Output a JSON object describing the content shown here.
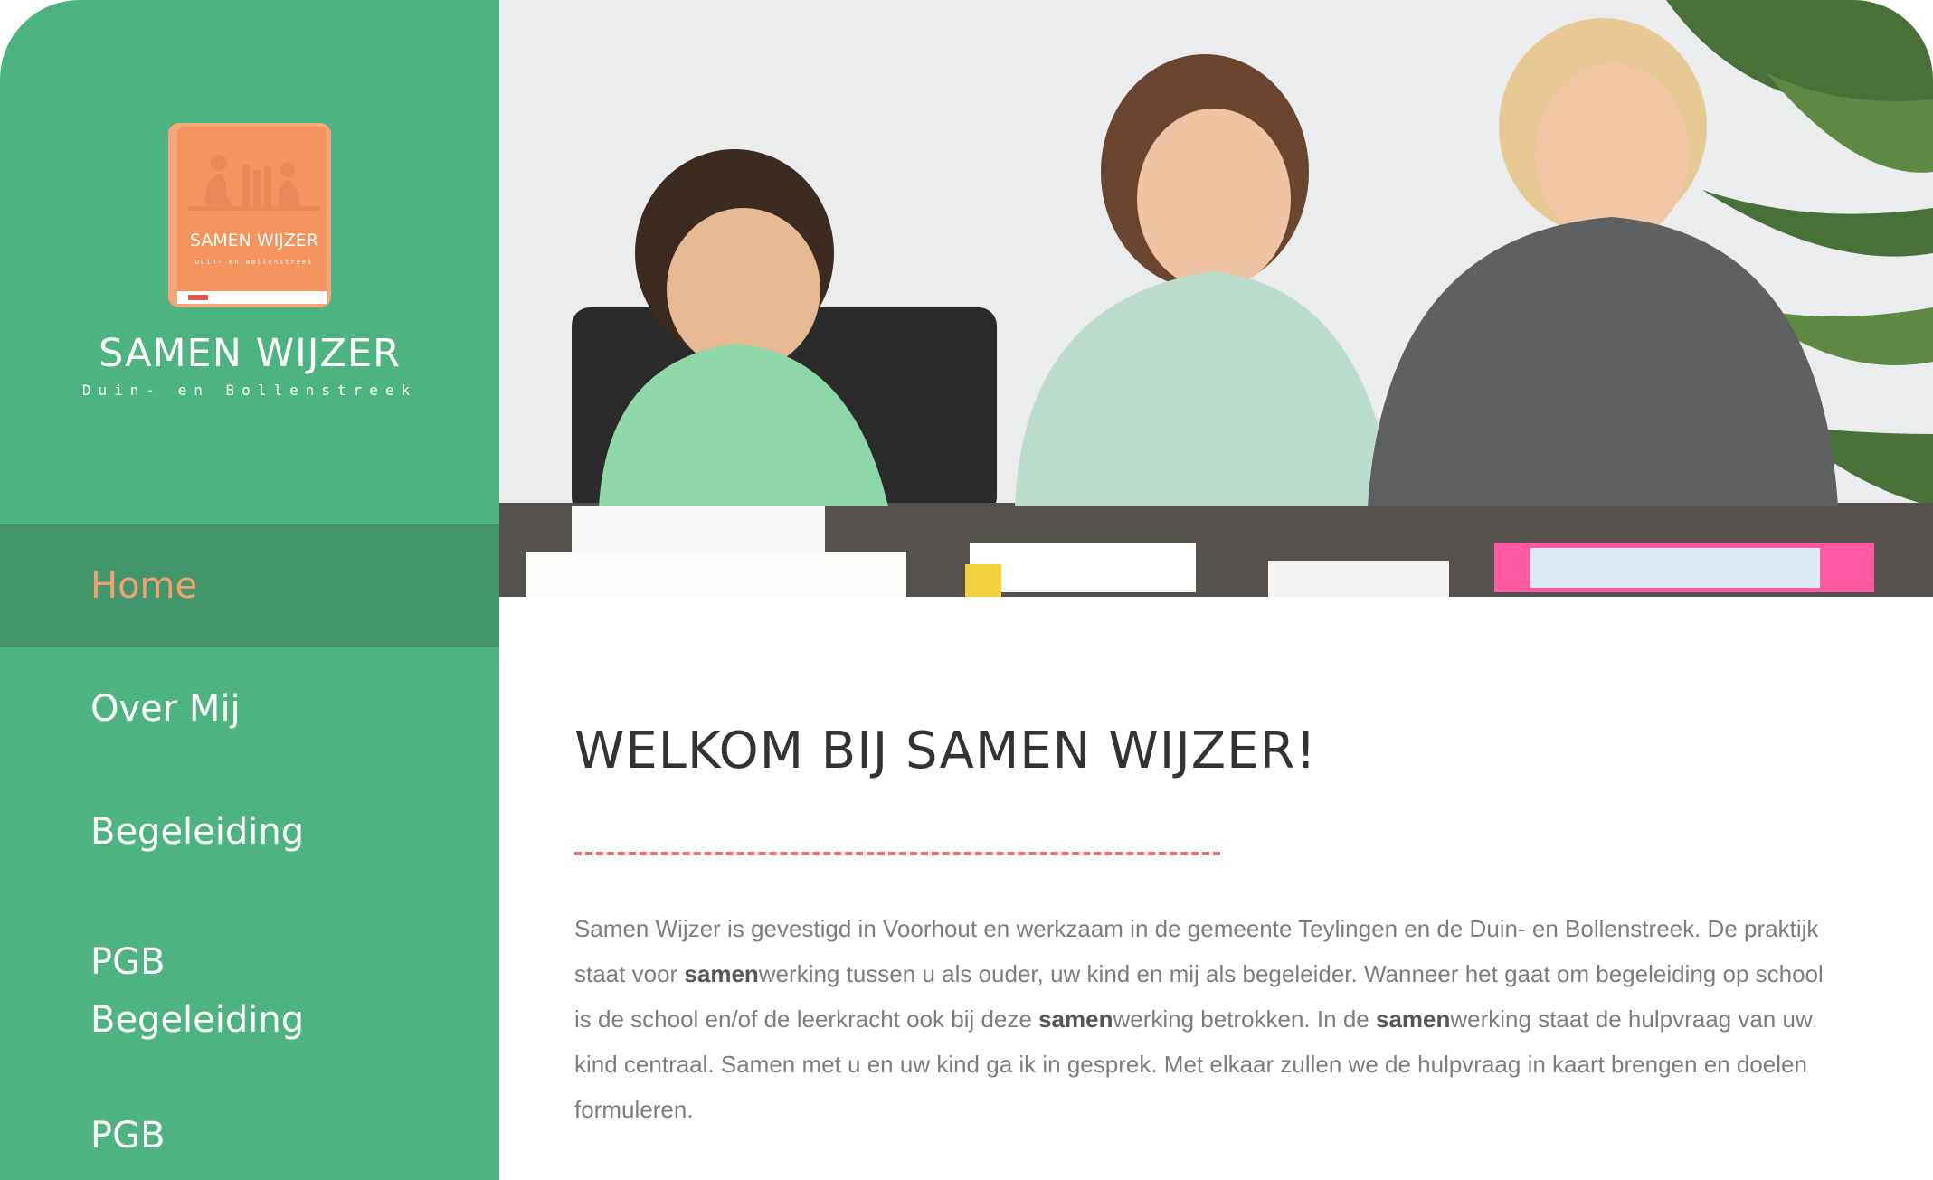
{
  "brand": {
    "logo_title": "SAMEN WIJZER",
    "logo_subtitle": "Duin- en Bollenstreek",
    "title": "SAMEN WIJZER",
    "subtitle": "Duin- en Bollenstreek"
  },
  "nav": {
    "items": [
      {
        "label": "Home",
        "active": true
      },
      {
        "label": "Over Mij"
      },
      {
        "label": "Begeleiding"
      },
      {
        "label_line1": "PGB",
        "label_line2": "Begeleiding"
      },
      {
        "label": "PGB"
      }
    ]
  },
  "main": {
    "title": "WELKOM BIJ SAMEN WIJZER!",
    "intro": {
      "p1": "Samen Wijzer is gevestigd in Voorhout en werkzaam in de gemeente Teylingen en de Duin- en Bollenstreek. De praktijk staat voor ",
      "b1": "samen",
      "p2": "werking tussen u als ouder, uw kind en mij als begeleider. Wanneer het gaat om begeleiding op school is de school en/of de leerkracht ook bij deze ",
      "b2": "samen",
      "p3": "werking betrokken. In de ",
      "b3": "samen",
      "p4": "werking staat de hulpvraag van uw kind centraal. Samen met u en uw kind ga ik in gesprek. Met elkaar zullen we de hulpvraag in kaart brengen en doelen formuleren."
    }
  },
  "colors": {
    "sidebar": "#4db380",
    "nav_active_bg": "#42966c",
    "nav_active_text": "#f4a06c",
    "divider": "#f06b6b",
    "logo_book": "#f4955f"
  }
}
